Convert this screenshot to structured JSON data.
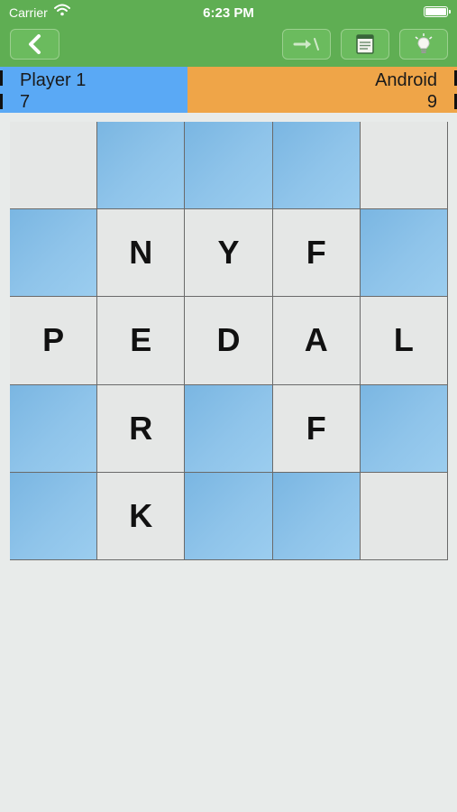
{
  "status_bar": {
    "carrier": "Carrier",
    "time": "6:23 PM"
  },
  "toolbar": {
    "back_icon": "chevron-left-icon",
    "swap_icon": "swap-arrow-icon",
    "notes_icon": "notepad-icon",
    "hint_icon": "lightbulb-icon"
  },
  "players": [
    {
      "name": "Player 1",
      "score": "7",
      "color": "#5aa9f5"
    },
    {
      "name": "Android",
      "score": "9",
      "color": "#efa548"
    }
  ],
  "board": {
    "size": 5,
    "rows": [
      [
        {
          "letter": "",
          "tile": "white"
        },
        {
          "letter": "",
          "tile": "blue"
        },
        {
          "letter": "",
          "tile": "blue"
        },
        {
          "letter": "",
          "tile": "blue"
        },
        {
          "letter": "",
          "tile": "white"
        }
      ],
      [
        {
          "letter": "",
          "tile": "blue"
        },
        {
          "letter": "N",
          "tile": "white"
        },
        {
          "letter": "Y",
          "tile": "white"
        },
        {
          "letter": "F",
          "tile": "white"
        },
        {
          "letter": "",
          "tile": "blue"
        }
      ],
      [
        {
          "letter": "P",
          "tile": "white"
        },
        {
          "letter": "E",
          "tile": "white"
        },
        {
          "letter": "D",
          "tile": "white"
        },
        {
          "letter": "A",
          "tile": "white"
        },
        {
          "letter": "L",
          "tile": "white"
        }
      ],
      [
        {
          "letter": "",
          "tile": "blue"
        },
        {
          "letter": "R",
          "tile": "white"
        },
        {
          "letter": "",
          "tile": "blue"
        },
        {
          "letter": "F",
          "tile": "white"
        },
        {
          "letter": "",
          "tile": "blue"
        }
      ],
      [
        {
          "letter": "",
          "tile": "blue"
        },
        {
          "letter": "K",
          "tile": "white"
        },
        {
          "letter": "",
          "tile": "blue"
        },
        {
          "letter": "",
          "tile": "blue"
        },
        {
          "letter": "",
          "tile": "white"
        }
      ]
    ]
  },
  "colors": {
    "toolbar": "#5fae53",
    "blue_tile": "#8fc4ea",
    "white_tile": "#e5e7e6",
    "background": "#e8ebea"
  }
}
